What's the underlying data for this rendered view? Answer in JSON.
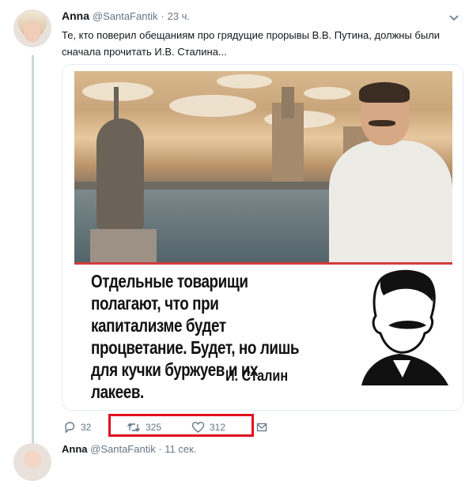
{
  "tweet": {
    "author_name": "Anna",
    "author_handle": "@SantaFantik",
    "separator": "·",
    "timestamp": "23 ч.",
    "text": "Те, кто поверил обещаниям про грядущие прорывы В.В. Путина, должны были сначала прочитать И.В. Сталина...",
    "image_quote": "Отдельные товарищи полагают, что при капитализме будет процветание. Будет, но лишь для кучки буржуев и их лакеев.",
    "image_attribution": "И. Сталин",
    "actions": {
      "reply_count": "32",
      "retweet_count": "325",
      "like_count": "312"
    }
  },
  "next_tweet": {
    "author_name": "Anna",
    "author_handle": "@SantaFantik",
    "separator": "·",
    "timestamp": "11 сек."
  },
  "colors": {
    "highlight": "#e0101f",
    "thread_line": "#ccd6dd",
    "secondary_text": "#657786"
  },
  "icons": [
    "chevron-down-icon",
    "reply-icon",
    "retweet-icon",
    "like-icon",
    "message-icon"
  ]
}
